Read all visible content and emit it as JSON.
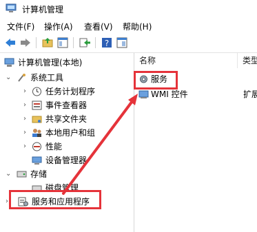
{
  "window": {
    "title": "计算机管理"
  },
  "menu": [
    {
      "label": "文件(F)"
    },
    {
      "label": "操作(A)"
    },
    {
      "label": "查看(V)"
    },
    {
      "label": "帮助(H)"
    }
  ],
  "tree": {
    "root": "计算机管理(本地)",
    "system_tools": "系统工具",
    "children": [
      {
        "label": "任务计划程序"
      },
      {
        "label": "事件查看器"
      },
      {
        "label": "共享文件夹"
      },
      {
        "label": "本地用户和组"
      },
      {
        "label": "性能"
      },
      {
        "label": "设备管理器"
      }
    ],
    "storage": "存储",
    "disk_management": "磁盘管理",
    "services_apps": "服务和应用程序"
  },
  "list": {
    "columns": [
      {
        "label": "名称"
      },
      {
        "label": "类型"
      }
    ],
    "rows": [
      {
        "name": "服务",
        "type": ""
      },
      {
        "name": "WMI 控件",
        "type": "扩展"
      }
    ]
  },
  "colors": {
    "highlight": "#e5333a",
    "accent": "#1e6fd9"
  },
  "icons": [
    "computer-management-icon",
    "back-arrow-icon",
    "forward-arrow-icon",
    "folder-up-icon",
    "console-tree-icon",
    "export-icon",
    "help-icon",
    "properties-icon",
    "computer-icon",
    "tools-icon",
    "clock-icon",
    "event-viewer-icon",
    "shared-folder-icon",
    "users-icon",
    "performance-icon",
    "device-manager-icon",
    "storage-icon",
    "disk-icon",
    "services-apps-icon",
    "gear-icon",
    "wmi-icon"
  ]
}
